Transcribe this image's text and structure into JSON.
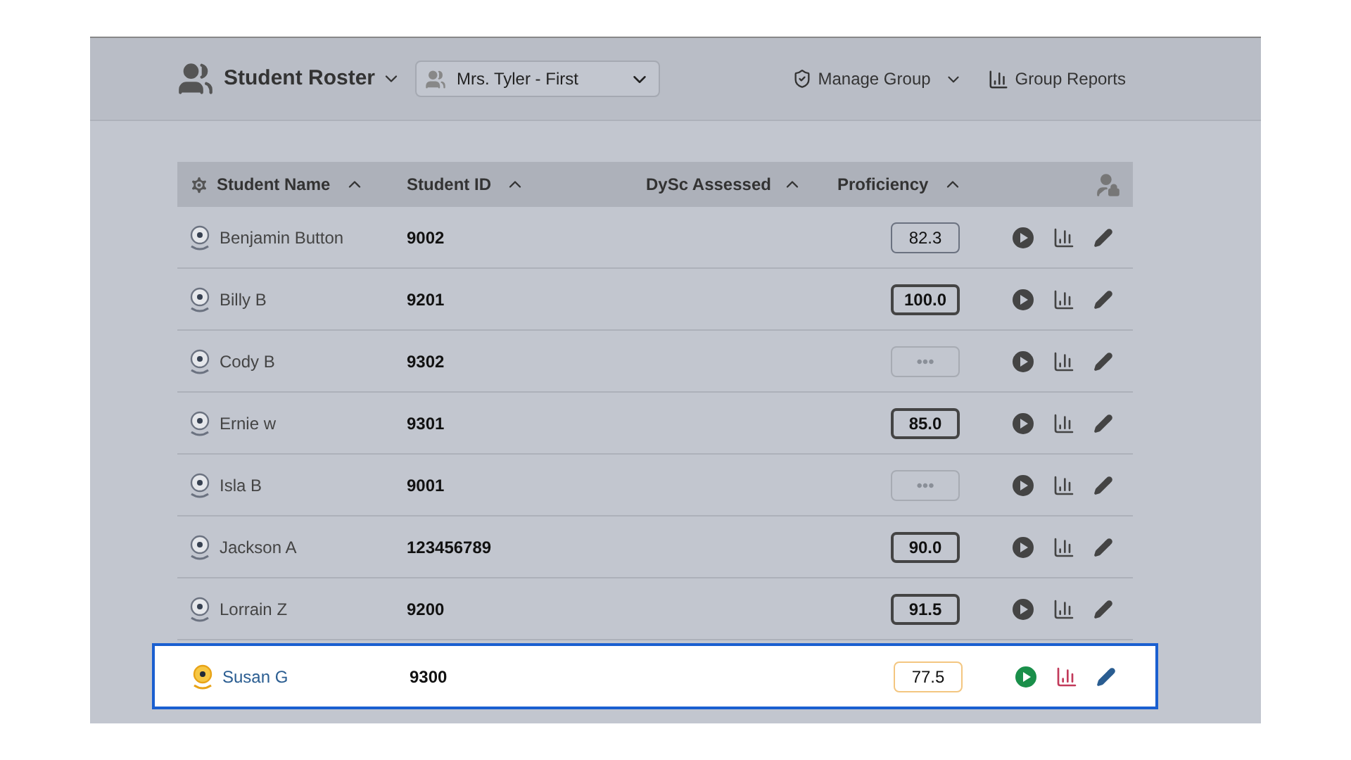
{
  "header": {
    "title": "Student Roster",
    "group_select": {
      "value": "Mrs. Tyler - First"
    },
    "actions": [
      {
        "label": "Manage Group",
        "kind": "menu"
      },
      {
        "label": "Group Reports",
        "kind": "reports"
      }
    ]
  },
  "table": {
    "columns": [
      {
        "label": "Student Name",
        "kind": "settings"
      },
      {
        "label": "Student ID",
        "kind": "plain"
      },
      {
        "label": "DySc Assessed",
        "kind": "plain"
      },
      {
        "label": "Proficiency",
        "kind": "plain"
      }
    ],
    "rows": [
      {
        "name": "Benjamin Button",
        "id": "9002",
        "proficiency": "82.3",
        "kind": "normal",
        "selected": false
      },
      {
        "name": "Billy B",
        "id": "9201",
        "proficiency": "100.0",
        "kind": "strong",
        "selected": false
      },
      {
        "name": "Cody B",
        "id": "9302",
        "proficiency": "•••",
        "kind": "empty",
        "selected": false
      },
      {
        "name": "Ernie w",
        "id": "9301",
        "proficiency": "85.0",
        "kind": "strong",
        "selected": false
      },
      {
        "name": "Isla B",
        "id": "9001",
        "proficiency": "•••",
        "kind": "empty",
        "selected": false
      },
      {
        "name": "Jackson A",
        "id": "123456789",
        "proficiency": "90.0",
        "kind": "strong",
        "selected": false
      },
      {
        "name": "Lorrain Z",
        "id": "9200",
        "proficiency": "91.5",
        "kind": "strong",
        "selected": false
      },
      {
        "name": "Susan G",
        "id": "9300",
        "proficiency": "77.5",
        "kind": "highlight",
        "selected": true
      }
    ]
  }
}
